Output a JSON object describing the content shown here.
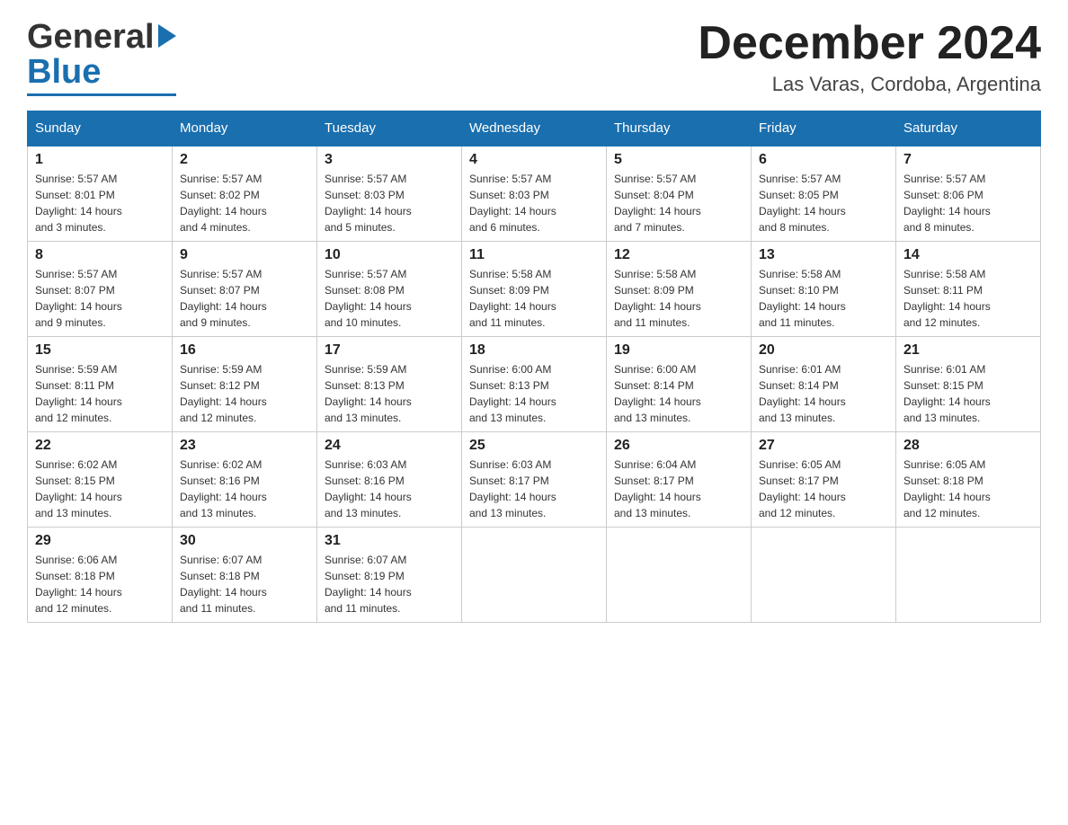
{
  "logo": {
    "line1": "General",
    "line2": "Blue",
    "line1_color": "#333",
    "line2_color": "#1a6faf"
  },
  "title": "December 2024",
  "subtitle": "Las Varas, Cordoba, Argentina",
  "columns": [
    "Sunday",
    "Monday",
    "Tuesday",
    "Wednesday",
    "Thursday",
    "Friday",
    "Saturday"
  ],
  "weeks": [
    [
      {
        "day": "1",
        "sunrise": "5:57 AM",
        "sunset": "8:01 PM",
        "daylight": "14 hours and 3 minutes."
      },
      {
        "day": "2",
        "sunrise": "5:57 AM",
        "sunset": "8:02 PM",
        "daylight": "14 hours and 4 minutes."
      },
      {
        "day": "3",
        "sunrise": "5:57 AM",
        "sunset": "8:03 PM",
        "daylight": "14 hours and 5 minutes."
      },
      {
        "day": "4",
        "sunrise": "5:57 AM",
        "sunset": "8:03 PM",
        "daylight": "14 hours and 6 minutes."
      },
      {
        "day": "5",
        "sunrise": "5:57 AM",
        "sunset": "8:04 PM",
        "daylight": "14 hours and 7 minutes."
      },
      {
        "day": "6",
        "sunrise": "5:57 AM",
        "sunset": "8:05 PM",
        "daylight": "14 hours and 8 minutes."
      },
      {
        "day": "7",
        "sunrise": "5:57 AM",
        "sunset": "8:06 PM",
        "daylight": "14 hours and 8 minutes."
      }
    ],
    [
      {
        "day": "8",
        "sunrise": "5:57 AM",
        "sunset": "8:07 PM",
        "daylight": "14 hours and 9 minutes."
      },
      {
        "day": "9",
        "sunrise": "5:57 AM",
        "sunset": "8:07 PM",
        "daylight": "14 hours and 9 minutes."
      },
      {
        "day": "10",
        "sunrise": "5:57 AM",
        "sunset": "8:08 PM",
        "daylight": "14 hours and 10 minutes."
      },
      {
        "day": "11",
        "sunrise": "5:58 AM",
        "sunset": "8:09 PM",
        "daylight": "14 hours and 11 minutes."
      },
      {
        "day": "12",
        "sunrise": "5:58 AM",
        "sunset": "8:09 PM",
        "daylight": "14 hours and 11 minutes."
      },
      {
        "day": "13",
        "sunrise": "5:58 AM",
        "sunset": "8:10 PM",
        "daylight": "14 hours and 11 minutes."
      },
      {
        "day": "14",
        "sunrise": "5:58 AM",
        "sunset": "8:11 PM",
        "daylight": "14 hours and 12 minutes."
      }
    ],
    [
      {
        "day": "15",
        "sunrise": "5:59 AM",
        "sunset": "8:11 PM",
        "daylight": "14 hours and 12 minutes."
      },
      {
        "day": "16",
        "sunrise": "5:59 AM",
        "sunset": "8:12 PM",
        "daylight": "14 hours and 12 minutes."
      },
      {
        "day": "17",
        "sunrise": "5:59 AM",
        "sunset": "8:13 PM",
        "daylight": "14 hours and 13 minutes."
      },
      {
        "day": "18",
        "sunrise": "6:00 AM",
        "sunset": "8:13 PM",
        "daylight": "14 hours and 13 minutes."
      },
      {
        "day": "19",
        "sunrise": "6:00 AM",
        "sunset": "8:14 PM",
        "daylight": "14 hours and 13 minutes."
      },
      {
        "day": "20",
        "sunrise": "6:01 AM",
        "sunset": "8:14 PM",
        "daylight": "14 hours and 13 minutes."
      },
      {
        "day": "21",
        "sunrise": "6:01 AM",
        "sunset": "8:15 PM",
        "daylight": "14 hours and 13 minutes."
      }
    ],
    [
      {
        "day": "22",
        "sunrise": "6:02 AM",
        "sunset": "8:15 PM",
        "daylight": "14 hours and 13 minutes."
      },
      {
        "day": "23",
        "sunrise": "6:02 AM",
        "sunset": "8:16 PM",
        "daylight": "14 hours and 13 minutes."
      },
      {
        "day": "24",
        "sunrise": "6:03 AM",
        "sunset": "8:16 PM",
        "daylight": "14 hours and 13 minutes."
      },
      {
        "day": "25",
        "sunrise": "6:03 AM",
        "sunset": "8:17 PM",
        "daylight": "14 hours and 13 minutes."
      },
      {
        "day": "26",
        "sunrise": "6:04 AM",
        "sunset": "8:17 PM",
        "daylight": "14 hours and 13 minutes."
      },
      {
        "day": "27",
        "sunrise": "6:05 AM",
        "sunset": "8:17 PM",
        "daylight": "14 hours and 12 minutes."
      },
      {
        "day": "28",
        "sunrise": "6:05 AM",
        "sunset": "8:18 PM",
        "daylight": "14 hours and 12 minutes."
      }
    ],
    [
      {
        "day": "29",
        "sunrise": "6:06 AM",
        "sunset": "8:18 PM",
        "daylight": "14 hours and 12 minutes."
      },
      {
        "day": "30",
        "sunrise": "6:07 AM",
        "sunset": "8:18 PM",
        "daylight": "14 hours and 11 minutes."
      },
      {
        "day": "31",
        "sunrise": "6:07 AM",
        "sunset": "8:19 PM",
        "daylight": "14 hours and 11 minutes."
      },
      null,
      null,
      null,
      null
    ]
  ],
  "labels": {
    "sunrise": "Sunrise:",
    "sunset": "Sunset:",
    "daylight": "Daylight:"
  }
}
